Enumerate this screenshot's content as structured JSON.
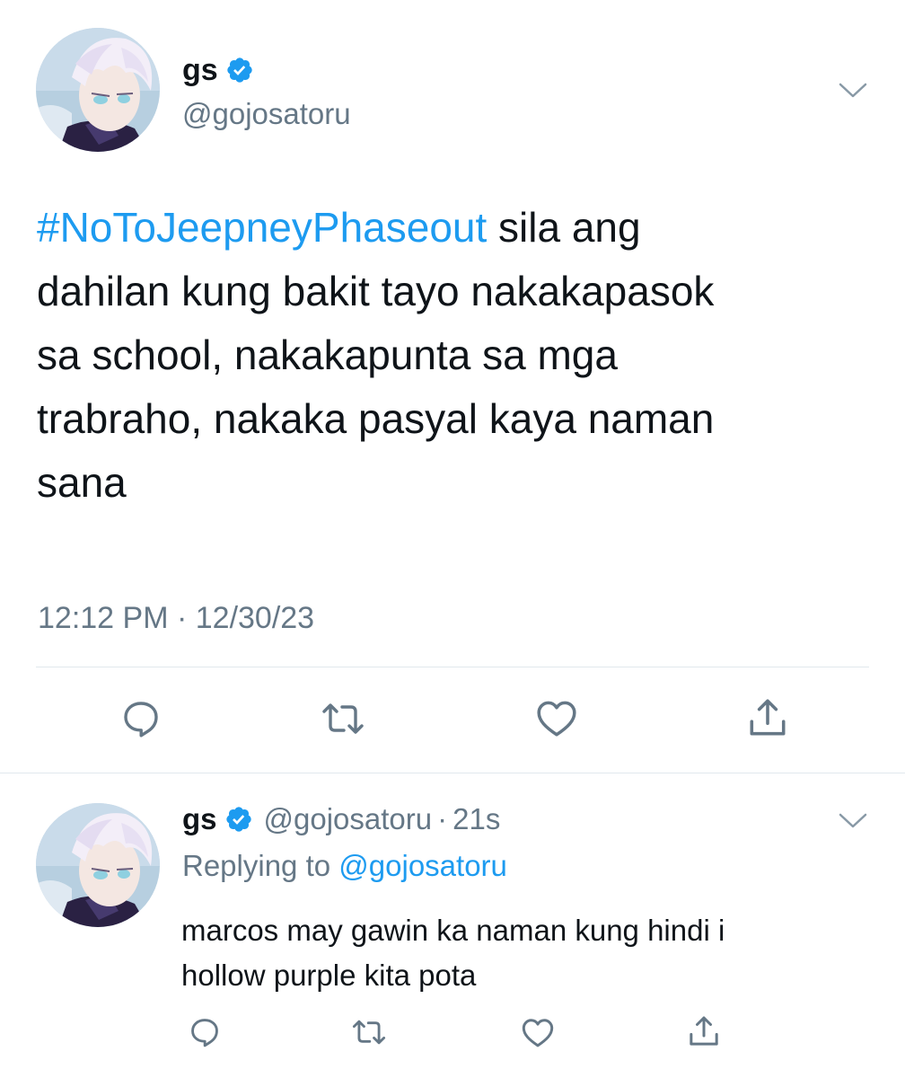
{
  "colors": {
    "accent": "#1d9bf0",
    "text": "#0f1419",
    "muted": "#657786",
    "divider": "#e1e8ed",
    "action_icon": "#657786"
  },
  "main_tweet": {
    "display_name": "gs",
    "handle": "@gojosatoru",
    "verified": true,
    "hashtag": "#NoToJeepneyPhaseout",
    "body_lines": [
      " sila ang",
      "dahilan kung bakit tayo nakakapasok",
      "sa school, nakakapunta sa mga",
      "trabraho, nakaka pasyal kaya naman",
      "sana"
    ],
    "timestamp": "12:12 PM · 12/30/23",
    "actions": [
      "reply-icon",
      "retweet-icon",
      "like-icon",
      "share-icon"
    ],
    "menu_icon": "chevron-down-icon"
  },
  "reply_tweet": {
    "display_name": "gs",
    "handle": "@gojosatoru",
    "separator": "·",
    "time": "21s",
    "replying_prefix": "Replying to",
    "replying_to": "@gojosatoru",
    "body_lines": [
      "marcos may gawin ka naman kung hindi i",
      "hollow purple kita pota"
    ],
    "actions": [
      "reply-icon",
      "retweet-icon",
      "like-icon",
      "share-icon"
    ],
    "menu_icon": "chevron-down-icon"
  }
}
